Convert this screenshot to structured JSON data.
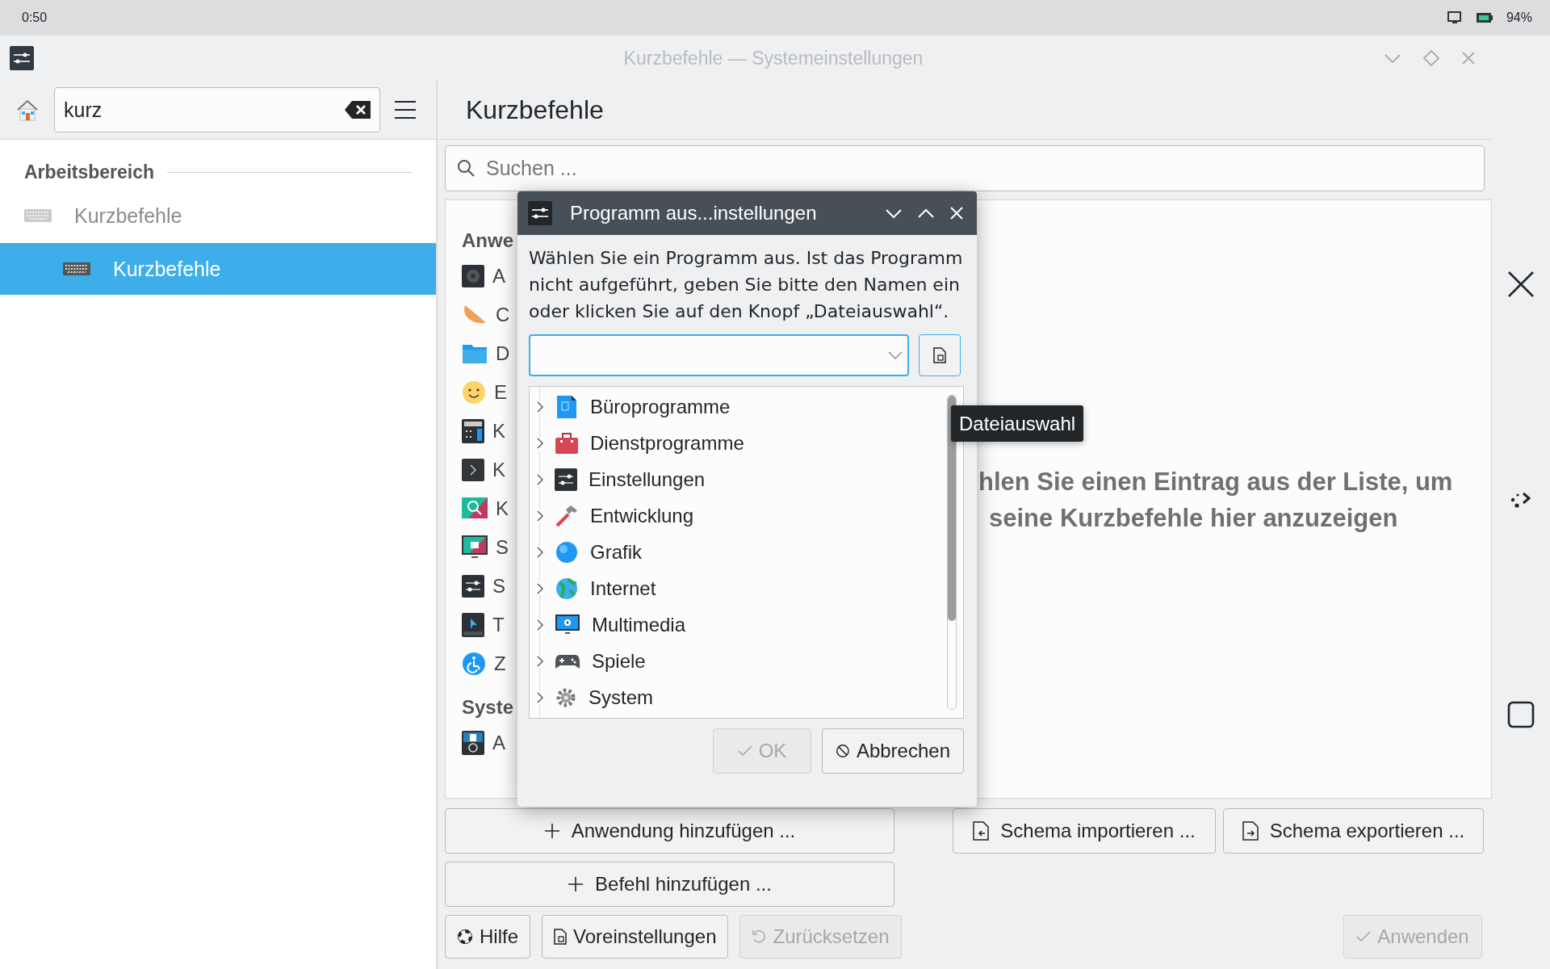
{
  "status_bar": {
    "time": "0:50",
    "battery": "94%"
  },
  "window": {
    "title": "Kurzbefehle — Systemeinstellungen"
  },
  "sidebar": {
    "search": {
      "value": "kurz"
    },
    "section": "Arbeitsbereich",
    "items": [
      {
        "label": "Kurzbefehle",
        "selected": false,
        "children": [
          {
            "label": "Kurzbefehle",
            "selected": true
          }
        ]
      }
    ]
  },
  "page": {
    "title": "Kurzbefehle",
    "search": {
      "placeholder": "Suchen ..."
    },
    "app_groups": [
      {
        "heading": "Anwe",
        "items": [
          {
            "kind": "speaker",
            "label": "A"
          },
          {
            "kind": "slice",
            "label": "C"
          },
          {
            "kind": "folder",
            "label": "D"
          },
          {
            "kind": "smiley",
            "label": "E"
          },
          {
            "kind": "calculator",
            "label": "K"
          },
          {
            "kind": "terminal",
            "label": "K"
          },
          {
            "kind": "magnifier",
            "label": "K"
          },
          {
            "kind": "screenshot",
            "label": "S"
          },
          {
            "kind": "sliders",
            "label": "S"
          },
          {
            "kind": "cursor",
            "label": "T"
          },
          {
            "kind": "accessibility",
            "label": "Z"
          }
        ]
      },
      {
        "heading": "Syste",
        "items": [
          {
            "kind": "docglobe",
            "label": "A"
          }
        ]
      }
    ],
    "empty_message": [
      "hlen Sie einen Eintrag aus der Liste, um",
      "seine Kurzbefehle hier anzuzeigen"
    ],
    "add_buttons": [
      {
        "kind": "plus",
        "label": "Anwendung hinzufügen ..."
      },
      {
        "kind": "plus",
        "label": "Befehl hinzufügen ..."
      }
    ],
    "schema_buttons": [
      {
        "kind": "import",
        "label": "Schema importieren ..."
      },
      {
        "kind": "export",
        "label": "Schema exportieren ..."
      }
    ],
    "footer_buttons": [
      {
        "kind": "help",
        "label": "Hilfe",
        "disabled": false
      },
      {
        "kind": "defaults",
        "label": "Voreinstellungen",
        "disabled": false
      },
      {
        "kind": "reset",
        "label": "Zurücksetzen",
        "disabled": true
      }
    ],
    "apply_button": {
      "kind": "apply",
      "label": "Anwenden",
      "disabled": true
    }
  },
  "dialog": {
    "title": "Programm aus...instellungen",
    "message": "Wählen Sie ein Programm aus. Ist das Programm nicht aufgeführt, geben Sie bitte den Namen ein oder klicken Sie auf den Knopf „Dateiauswahl“.",
    "tree": [
      {
        "kind": "office",
        "label": "Büroprogramme",
        "expanded": false
      },
      {
        "kind": "toolbox",
        "label": "Dienstprogramme",
        "expanded": false
      },
      {
        "kind": "sliders",
        "label": "Einstellungen",
        "expanded": false
      },
      {
        "kind": "hammer",
        "label": "Entwicklung",
        "expanded": false
      },
      {
        "kind": "sphere",
        "label": "Grafik",
        "expanded": false
      },
      {
        "kind": "globe",
        "label": "Internet",
        "expanded": false
      },
      {
        "kind": "monitor",
        "label": "Multimedia",
        "expanded": false
      },
      {
        "kind": "gamepad",
        "label": "Spiele",
        "expanded": false
      },
      {
        "kind": "gear",
        "label": "System",
        "expanded": false
      }
    ],
    "buttons": [
      {
        "kind": "ok",
        "label": "OK",
        "disabled": true
      },
      {
        "kind": "cancel",
        "label": "Abbrechen",
        "disabled": false
      }
    ]
  },
  "tooltip": "Dateiauswahl"
}
